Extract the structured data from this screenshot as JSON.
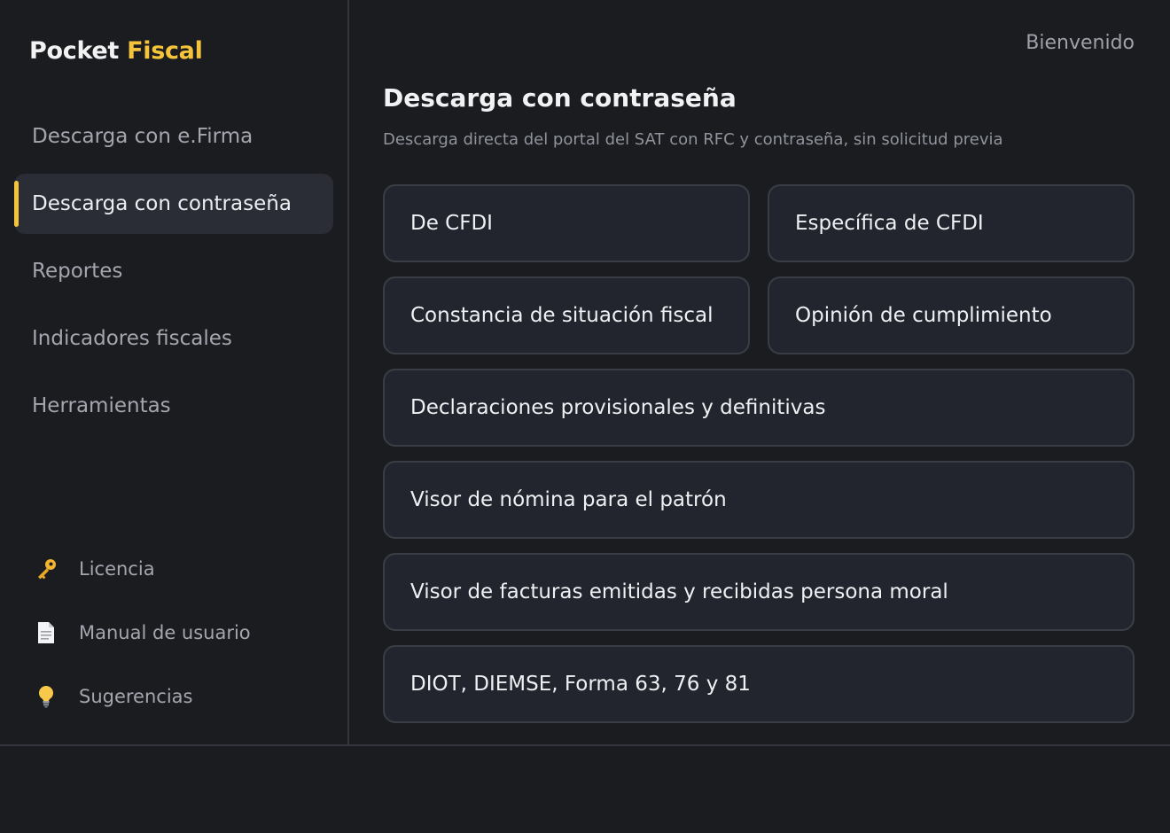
{
  "brand": {
    "part1": "Pocket",
    "part2": "Fiscal"
  },
  "nav": {
    "items": [
      {
        "label": "Descarga con e.Firma"
      },
      {
        "label": "Descarga con contraseña",
        "active": true
      },
      {
        "label": "Reportes"
      },
      {
        "label": "Indicadores fiscales"
      },
      {
        "label": "Herramientas"
      }
    ]
  },
  "footer": {
    "license": {
      "label": "Licencia",
      "icon": "key-icon"
    },
    "manual": {
      "label": "Manual de usuario",
      "icon": "document-icon"
    },
    "suggestions": {
      "label": "Sugerencias",
      "icon": "lightbulb-icon"
    }
  },
  "header": {
    "welcome": "Bienvenido"
  },
  "page": {
    "title": "Descarga con contraseña",
    "subtitle": "Descarga directa del portal del SAT con RFC y contraseña, sin solicitud previa"
  },
  "cards": [
    {
      "label": "De CFDI"
    },
    {
      "label": "Específica de CFDI"
    },
    {
      "label": "Constancia de situación fiscal"
    },
    {
      "label": "Opinión de cumplimiento"
    },
    {
      "label": "Declaraciones provisionales y definitivas"
    },
    {
      "label": "Visor de nómina para el patrón"
    },
    {
      "label": "Visor de facturas emitidas y recibidas persona moral"
    },
    {
      "label": "DIOT, DIEMSE, Forma 63, 76 y 81"
    }
  ],
  "colors": {
    "accent": "#f5c43a",
    "background": "#1b1c20",
    "card": "#22252d",
    "active_nav": "#2a2d35"
  }
}
